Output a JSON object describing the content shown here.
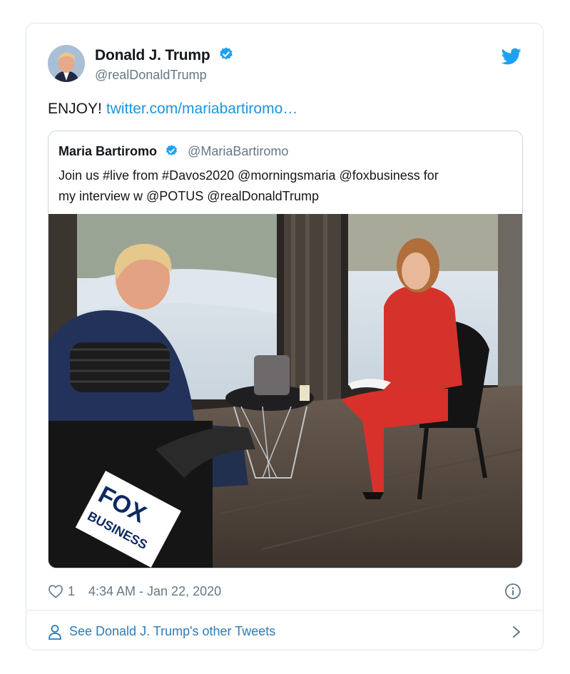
{
  "tweet": {
    "author_name": "Donald J. Trump",
    "author_handle": "@realDonaldTrump",
    "text": "ENJOY!",
    "link": "twitter.com/mariabartiromo…",
    "likes": "1",
    "timestamp": "4:34 AM - Jan 22, 2020",
    "more_link": "See Donald J. Trump's other Tweets"
  },
  "quoted": {
    "author_name": "Maria Bartiromo",
    "author_handle": "@MariaBartiromo",
    "text_line1": "Join us #live from #Davos2020 @morningsmaria @foxbusiness for",
    "text_line2": "my interview w  @POTUS  @realDonaldTrump",
    "photo_logo_line1": "FOX",
    "photo_logo_line2": "BUSINESS"
  },
  "icons": {
    "verified": "verified-badge-icon",
    "bird": "twitter-bird-icon",
    "heart": "heart-icon",
    "info": "info-icon",
    "person": "person-icon",
    "chevron": "chevron-right-icon"
  },
  "colors": {
    "accent": "#1da1f2",
    "link": "#1b95e0",
    "secondary": "#657786",
    "border": "#e1e8ed"
  }
}
